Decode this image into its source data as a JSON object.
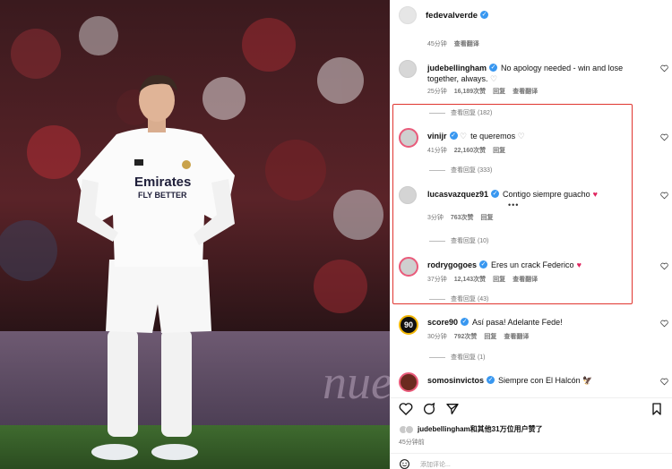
{
  "post": {
    "author": "fedevalverde",
    "author_reply_meta": {
      "time": "45分钟",
      "translate": "查看翻译"
    }
  },
  "comments": [
    {
      "user": "judebellingham",
      "text": "No apology needed - win and lose together, always.",
      "time": "25分钟",
      "likes": "16,189次赞",
      "reply": "回复",
      "translate": "查看翻译",
      "replies": "查看回复 (182)"
    },
    {
      "user": "vinijr",
      "text": "te queremos",
      "time": "41分钟",
      "likes": "22,160次赞",
      "reply": "回复",
      "translate": "",
      "replies": "查看回复 (333)"
    },
    {
      "user": "lucasvazquez91",
      "text": "Contigo siempre guacho",
      "time": "3分钟",
      "likes": "763次赞",
      "reply": "回复",
      "translate": "",
      "replies": "查看回复 (10)"
    },
    {
      "user": "rodrygogoes",
      "text": "Eres un crack Federico",
      "time": "37分钟",
      "likes": "12,143次赞",
      "reply": "回复",
      "translate": "查看翻译",
      "replies": "查看回复 (43)"
    },
    {
      "user": "score90",
      "text": "Así pasa! Adelante Fede!",
      "time": "30分钟",
      "likes": "792次赞",
      "reply": "回复",
      "translate": "查看翻译",
      "replies": "查看回复 (1)"
    },
    {
      "user": "somosinvictos",
      "text": "Siempre con El Halcón 🦅",
      "time": "",
      "likes": "",
      "reply": "",
      "translate": "",
      "replies": ""
    }
  ],
  "footer": {
    "likes_by": "jude​bellingham和其他31万位用户赞了",
    "time": "45分钟前",
    "add_comment_placeholder": "添加评论..."
  },
  "photo": {
    "shirt_sponsor": "Emirates",
    "shirt_sponsor2": "FLY BETTER",
    "board_text": "nueva lí"
  },
  "colors": {
    "highlight": "#e0352f",
    "verified": "#3897f0",
    "heart_red": "#e0245e"
  }
}
